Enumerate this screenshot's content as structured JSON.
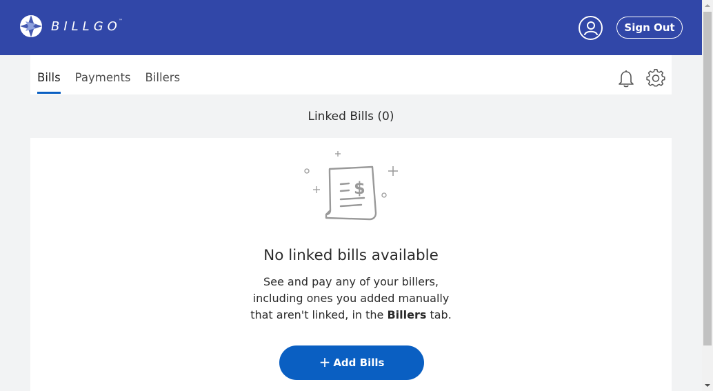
{
  "header": {
    "logo_text": "BILLGO",
    "logo_tm": "™",
    "account_icon": "user-circle-icon",
    "sign_out_label": "Sign Out",
    "brand_color": "#3147a8"
  },
  "tabs": [
    {
      "label": "Bills",
      "active": true
    },
    {
      "label": "Payments",
      "active": false
    },
    {
      "label": "Billers",
      "active": false
    }
  ],
  "toolbar": {
    "notifications_icon": "bell-icon",
    "settings_icon": "gear-icon"
  },
  "section": {
    "title": "Linked Bills (0)"
  },
  "empty_state": {
    "illustration_icon": "receipt-dollar-icon",
    "title": "No linked bills available",
    "line1": "See and pay any of your billers,",
    "line2": "including ones you added manually",
    "line3_prefix": "that aren't linked, in the ",
    "line3_bold": "Billers",
    "line3_suffix": " tab.",
    "button_plus": "+",
    "button_label": "Add Bills",
    "button_color": "#0a5fc2"
  }
}
